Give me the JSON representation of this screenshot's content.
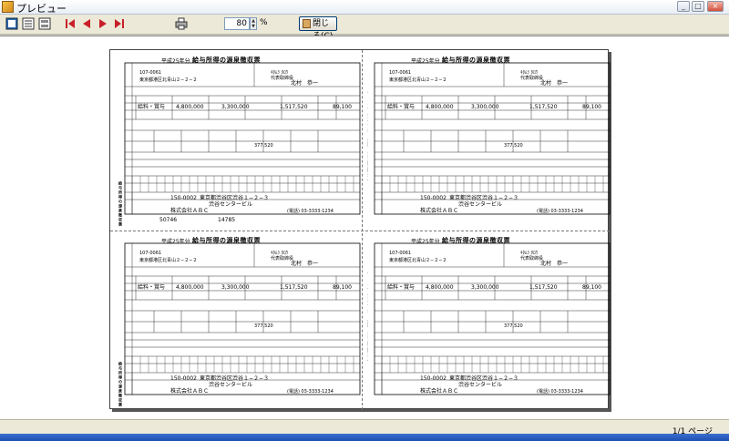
{
  "window": {
    "title": "プレビュー"
  },
  "toolbar": {
    "zoom_value": "80",
    "zoom_unit": "%",
    "close_label": "閉じる(C)"
  },
  "slip": {
    "title": "給与所得の源泉徴収票",
    "year": "平成25年分",
    "zip": "107-0061",
    "address": "東京都港区北青山２−２−２",
    "kana_name": "ｷﾀﾑﾗ ﾀﾛｳ",
    "title_role": "代表取締役",
    "name": "北村　恭一",
    "kind": "給料・賞与",
    "payment": "4,800,000",
    "after_deduction": "3,300,000",
    "deduction_total": "1,517,520",
    "withholding": "89,100",
    "social_insurance": "377,520",
    "payer_zip": "150-0002",
    "payer_address": "東京都渋谷区渋谷１−２−３",
    "payer_building": "渋谷センタービル",
    "payer_name": "株式会社ＡＢＣ",
    "phone": "(電話) 03-3333-1234",
    "receipt_no_a": "50746",
    "receipt_no_b": "14785",
    "vertical_label_stub": "給与所得の源泉徴収票",
    "vertical_label_payer": "給与支払報告書（個人別明細書）"
  },
  "status": {
    "page_indicator": "1/1 ページ"
  }
}
